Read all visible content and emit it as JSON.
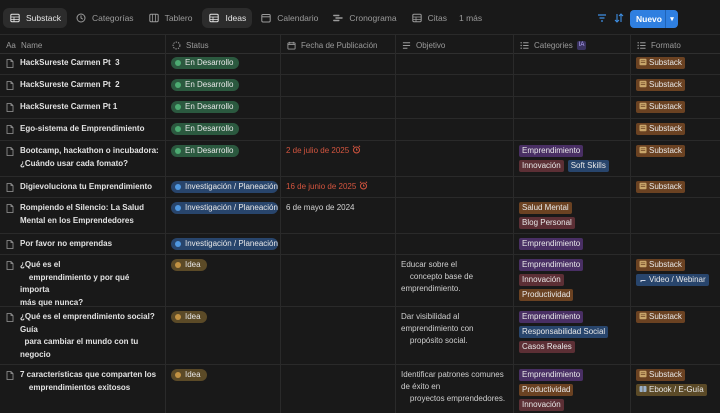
{
  "tabs": [
    {
      "label": "Substack",
      "icon": "table-icon",
      "active": true
    },
    {
      "label": "Categorías",
      "icon": "clock-icon",
      "active": false
    },
    {
      "label": "Tablero",
      "icon": "board-icon",
      "active": false
    },
    {
      "label": "Ideas",
      "icon": "table-icon",
      "active": true
    },
    {
      "label": "Calendario",
      "icon": "calendar-icon",
      "active": false
    },
    {
      "label": "Cronograma",
      "icon": "timeline-icon",
      "active": false
    },
    {
      "label": "Citas",
      "icon": "table-icon",
      "active": false
    }
  ],
  "more_label": "1 más",
  "new_button": {
    "label": "Nuevo",
    "color": "#2f7fe0"
  },
  "columns": {
    "name": "Name",
    "status": "Status",
    "date": "Fecha de Publicación",
    "objective": "Objetivo",
    "categories": "Categories",
    "categories_badge": "IA",
    "format": "Formato"
  },
  "rows": [
    {
      "name": "HackSureste Carmen Pt  3",
      "status": "En Desarrollo",
      "formats": [
        "Substack"
      ]
    },
    {
      "name": "HackSureste Carmen Pt  2",
      "status": "En Desarrollo",
      "formats": [
        "Substack"
      ]
    },
    {
      "name": "HackSureste Carmen Pt 1",
      "status": "En Desarrollo",
      "formats": [
        "Substack"
      ]
    },
    {
      "name": "Ego-sistema de Emprendimiento",
      "status": "En Desarrollo",
      "formats": [
        "Substack"
      ]
    },
    {
      "name": "Bootcamp, hackathon o incubadora:\n¿Cuándo usar cada fomato?",
      "status": "En Desarrollo",
      "date": "2 de julio de 2025",
      "categories": [
        "Emprendimiento",
        "Innovación",
        "Soft Skills"
      ],
      "formats": [
        "Substack"
      ]
    },
    {
      "name": "Digievoluciona tu Emprendimiento",
      "status": "Investigación / Planeación",
      "date": "16 de junio de 2025",
      "formats": [
        "Substack"
      ]
    },
    {
      "name": "Rompiendo el Silencio: La Salud\nMental en los Emprendedores",
      "status": "Investigación / Planeación",
      "date": "6 de mayo de 2024",
      "categories": [
        "Salud Mental",
        "Blog Personal"
      ]
    },
    {
      "name": "Por favor no emprendas",
      "status": "Investigación / Planeación",
      "categories": [
        "Emprendimiento"
      ]
    },
    {
      "name": "¿Qué es el\n    emprendimiento y por qué importa\nmás que nunca?",
      "status": "Idea",
      "objective": "Educar sobre el\n    concepto base de\nemprendimiento.",
      "categories": [
        "Emprendimiento",
        "Innovación",
        "Productividad"
      ],
      "formats": [
        "Substack",
        "Video / Webinar"
      ]
    },
    {
      "name": "¿Qué es el emprendimiento social?\nGuía\n  para cambiar el mundo con tu\nnegocio",
      "status": "Idea",
      "objective": "Dar visibilidad al\nemprendimiento con\n    propósito social.",
      "categories": [
        "Emprendimiento",
        "Responsabilidad Social",
        "Casos Reales"
      ],
      "formats": [
        "Substack"
      ]
    },
    {
      "name": "7 características que comparten los\n    emprendimientos exitosos",
      "status": "Idea",
      "objective": "Identificar patrones comunes\nde éxito en\n    proyectos emprendedores.",
      "categories": [
        "Emprendimiento",
        "Productividad",
        "Innovación"
      ],
      "formats": [
        "Substack",
        "Ebook / E-Guía"
      ]
    }
  ],
  "status_colors": {
    "En Desarrollo": "green",
    "Investigación / Planeación": "blue",
    "Idea": "brown"
  },
  "category_colors": {
    "Emprendimiento": "purple",
    "Innovación": "red",
    "Soft Skills": "blue",
    "Salud Mental": "orange",
    "Blog Personal": "red",
    "Productividad": "orange",
    "Responsabilidad Social": "blue",
    "Casos Reales": "red"
  },
  "format_colors": {
    "Substack": "orange",
    "Video / Webinar": "blue",
    "Ebook / E-Guía": "brown"
  }
}
